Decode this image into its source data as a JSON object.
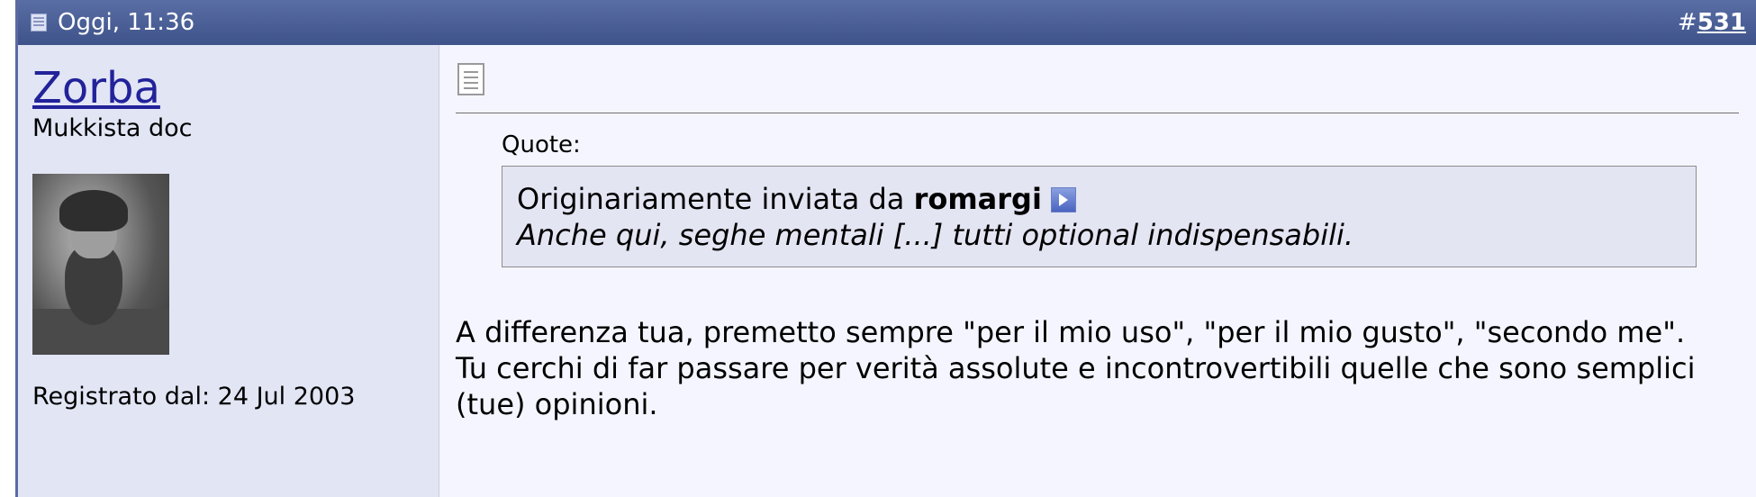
{
  "post": {
    "date": "Oggi, 11:36",
    "number_prefix": "#",
    "number": "531"
  },
  "user": {
    "name": "Zorba",
    "title": "Mukkista doc",
    "join_date": "Registrato dal: 24 Jul 2003"
  },
  "quote": {
    "label": "Quote:",
    "author_prefix": "Originariamente inviata da",
    "author": "romargi",
    "text": "Anche qui, seghe mentali [...] tutti optional indispensabili."
  },
  "message": {
    "paragraphs": [
      "A differenza tua, premetto sempre \"per il mio uso\", \"per il mio gusto\", \"secondo me\".",
      "Tu cerchi di far passare per verità assolute e incontrovertibili quelle che sono semplici (tue) opinioni."
    ]
  },
  "icons": {
    "post_status": "post-old-icon",
    "message_type": "document-icon",
    "view_post": "arrow-right-icon"
  },
  "colors": {
    "header": "#4a5f97",
    "username_link": "#22229a",
    "user_panel": "#e2e5f4",
    "quote_box": "#e4e5f3"
  }
}
